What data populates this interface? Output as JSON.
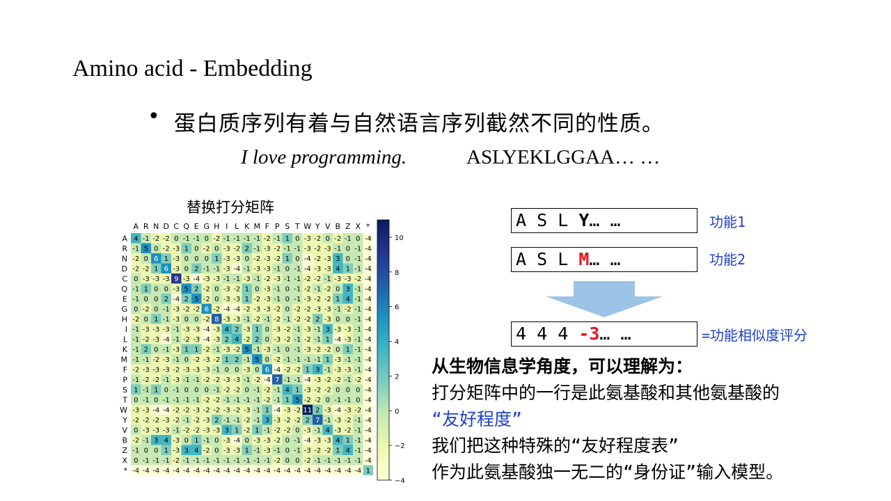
{
  "slide": {
    "title": "Amino acid - Embedding",
    "bullet": "蛋白质序列有着与自然语言序列截然不同的性质。",
    "example_sentence": "I love programming.",
    "example_sequence": "ASLYEKLGGAA… …"
  },
  "matrix": {
    "title": "替换打分矩阵",
    "amino_acids": [
      "A",
      "R",
      "N",
      "D",
      "C",
      "Q",
      "E",
      "G",
      "H",
      "I",
      "L",
      "K",
      "M",
      "F",
      "P",
      "S",
      "T",
      "W",
      "Y",
      "V",
      "B",
      "Z",
      "X",
      "*"
    ],
    "colorbar_ticks": [
      "10",
      "8",
      "6",
      "4",
      "2",
      "0",
      "−2",
      "−4"
    ],
    "colormap": [
      "#ffffd9",
      "#edf8b1",
      "#c7e9b4",
      "#7fcdbb",
      "#41b6c4",
      "#1d91c0",
      "#225ea8",
      "#253494",
      "#081d58"
    ],
    "rows": [
      [
        4,
        -1,
        -2,
        -2,
        0,
        -1,
        -1,
        0,
        -2,
        -1,
        -1,
        -1,
        -1,
        -2,
        -1,
        1,
        0,
        -3,
        -2,
        0,
        -2,
        -1,
        0,
        -4
      ],
      [
        -1,
        5,
        0,
        -2,
        -3,
        1,
        0,
        -2,
        0,
        -3,
        -2,
        2,
        -1,
        -3,
        -2,
        -1,
        -1,
        -3,
        -2,
        -3,
        -1,
        0,
        -1,
        -4
      ],
      [
        -2,
        0,
        6,
        1,
        -3,
        0,
        0,
        0,
        1,
        -3,
        -3,
        0,
        -2,
        -3,
        -2,
        1,
        0,
        -4,
        -2,
        -3,
        3,
        0,
        -1,
        -4
      ],
      [
        -2,
        -2,
        1,
        6,
        -3,
        0,
        2,
        -1,
        -1,
        -3,
        -4,
        -1,
        -3,
        -3,
        -1,
        0,
        -1,
        -4,
        -3,
        -3,
        4,
        1,
        -1,
        -4
      ],
      [
        0,
        -3,
        -3,
        -3,
        9,
        -3,
        -4,
        -3,
        -3,
        -1,
        -1,
        -3,
        -1,
        -2,
        -3,
        -1,
        -1,
        -2,
        -2,
        -1,
        -3,
        -3,
        -2,
        -4
      ],
      [
        -1,
        1,
        0,
        0,
        -3,
        5,
        2,
        -2,
        0,
        -3,
        -2,
        1,
        0,
        -3,
        -1,
        0,
        -1,
        -2,
        -1,
        -2,
        0,
        3,
        -1,
        -4
      ],
      [
        -1,
        0,
        0,
        2,
        -4,
        2,
        5,
        -2,
        0,
        -3,
        -3,
        1,
        -2,
        -3,
        -1,
        0,
        -1,
        -3,
        -2,
        -2,
        1,
        4,
        -1,
        -4
      ],
      [
        0,
        -2,
        0,
        -1,
        -3,
        -2,
        -2,
        6,
        -2,
        -4,
        -4,
        -2,
        -3,
        -3,
        -2,
        0,
        -2,
        -2,
        -3,
        -3,
        -1,
        -2,
        -1,
        -4
      ],
      [
        -2,
        0,
        1,
        -1,
        -3,
        0,
        0,
        -2,
        8,
        -3,
        -3,
        -1,
        -2,
        -1,
        -2,
        -1,
        -2,
        -2,
        2,
        -3,
        0,
        0,
        -1,
        -4
      ],
      [
        -1,
        -3,
        -3,
        -3,
        -1,
        -3,
        -3,
        -4,
        -3,
        4,
        2,
        -3,
        1,
        0,
        -3,
        -2,
        -1,
        -3,
        -1,
        3,
        -3,
        -3,
        -1,
        -4
      ],
      [
        -1,
        -2,
        -3,
        -4,
        -1,
        -2,
        -3,
        -4,
        -3,
        2,
        4,
        -2,
        2,
        0,
        -3,
        -2,
        -1,
        -2,
        -1,
        1,
        -4,
        -3,
        -1,
        -4
      ],
      [
        -1,
        2,
        0,
        -1,
        -3,
        1,
        1,
        -2,
        -1,
        -3,
        -2,
        5,
        -1,
        -3,
        -1,
        0,
        -1,
        -3,
        -2,
        -2,
        0,
        1,
        -1,
        -4
      ],
      [
        -1,
        -1,
        -2,
        -3,
        -1,
        0,
        -2,
        -3,
        -2,
        1,
        2,
        -1,
        5,
        0,
        -2,
        -1,
        -1,
        -1,
        -1,
        1,
        -3,
        -1,
        -1,
        -4
      ],
      [
        -2,
        -3,
        -3,
        -3,
        -2,
        -3,
        -3,
        -3,
        -1,
        0,
        0,
        -3,
        0,
        6,
        -4,
        -2,
        -2,
        1,
        3,
        -1,
        -3,
        -3,
        -1,
        -4
      ],
      [
        -1,
        -2,
        -2,
        -1,
        -3,
        -1,
        -1,
        -2,
        -2,
        -3,
        -3,
        -1,
        -2,
        -4,
        7,
        -1,
        -1,
        -4,
        -3,
        -2,
        -2,
        -1,
        -2,
        -4
      ],
      [
        1,
        -1,
        1,
        0,
        -1,
        0,
        0,
        0,
        -1,
        -2,
        -2,
        0,
        -1,
        -2,
        -1,
        4,
        1,
        -3,
        -2,
        -2,
        0,
        0,
        0,
        -4
      ],
      [
        0,
        -1,
        0,
        -1,
        -1,
        -1,
        -1,
        -2,
        -2,
        -1,
        -1,
        -1,
        -1,
        -2,
        -1,
        1,
        5,
        -2,
        -2,
        0,
        -1,
        -1,
        0,
        -4
      ],
      [
        -3,
        -3,
        -4,
        -4,
        -2,
        -2,
        -3,
        -2,
        -2,
        -3,
        -2,
        -3,
        -1,
        1,
        -4,
        -3,
        -2,
        11,
        2,
        -3,
        -4,
        -3,
        -2,
        -4
      ],
      [
        -2,
        -2,
        -2,
        -3,
        -2,
        -1,
        -2,
        -3,
        2,
        -1,
        -1,
        -2,
        -1,
        3,
        -3,
        -2,
        -2,
        2,
        7,
        -1,
        -3,
        -2,
        -1,
        -4
      ],
      [
        0,
        -3,
        -3,
        -3,
        -1,
        -2,
        -2,
        -3,
        -3,
        3,
        1,
        -2,
        1,
        -1,
        -2,
        -2,
        0,
        -3,
        -1,
        4,
        -3,
        -2,
        -1,
        -4
      ],
      [
        -2,
        -1,
        3,
        4,
        -3,
        0,
        1,
        -1,
        0,
        -3,
        -4,
        0,
        -3,
        -3,
        -2,
        0,
        -1,
        -4,
        -3,
        -3,
        4,
        1,
        -1,
        -4
      ],
      [
        -1,
        0,
        0,
        1,
        -3,
        3,
        4,
        -2,
        0,
        -3,
        -3,
        1,
        -1,
        -3,
        -1,
        0,
        -1,
        -3,
        -2,
        -2,
        1,
        4,
        -1,
        -4
      ],
      [
        0,
        -1,
        -1,
        -1,
        -2,
        -1,
        -1,
        -1,
        -1,
        -1,
        -1,
        -1,
        -1,
        -1,
        -2,
        0,
        0,
        -2,
        -1,
        -1,
        -1,
        -1,
        -1,
        -4
      ],
      [
        -4,
        -4,
        -4,
        -4,
        -4,
        -4,
        -4,
        -4,
        -4,
        -4,
        -4,
        -4,
        -4,
        -4,
        -4,
        -4,
        -4,
        -4,
        -4,
        -4,
        -4,
        -4,
        -4,
        1
      ]
    ]
  },
  "sequences": {
    "seq1_prefix": "A S L ",
    "seq1_highlight": "Y",
    "seq1_suffix": "… …",
    "seq1_label": "功能1",
    "seq2_prefix": "A S L ",
    "seq2_highlight": "M",
    "seq2_suffix": "… …",
    "seq2_label": "功能2",
    "score_prefix": "4 4 4 ",
    "score_highlight": "-3",
    "score_suffix": "… …",
    "score_label": "=功能相似度评分",
    "highlight_color": "#e8161b"
  },
  "explanation": {
    "line1": "从生物信息学角度，可以理解为：",
    "line2": "打分矩阵中的一行是此氨基酸和其他氨基酸的",
    "line3": "“友好程度”",
    "line4": "我们把这种特殊的“友好程度表”",
    "line5": "作为此氨基酸独一无二的“身份证”输入模型。"
  }
}
